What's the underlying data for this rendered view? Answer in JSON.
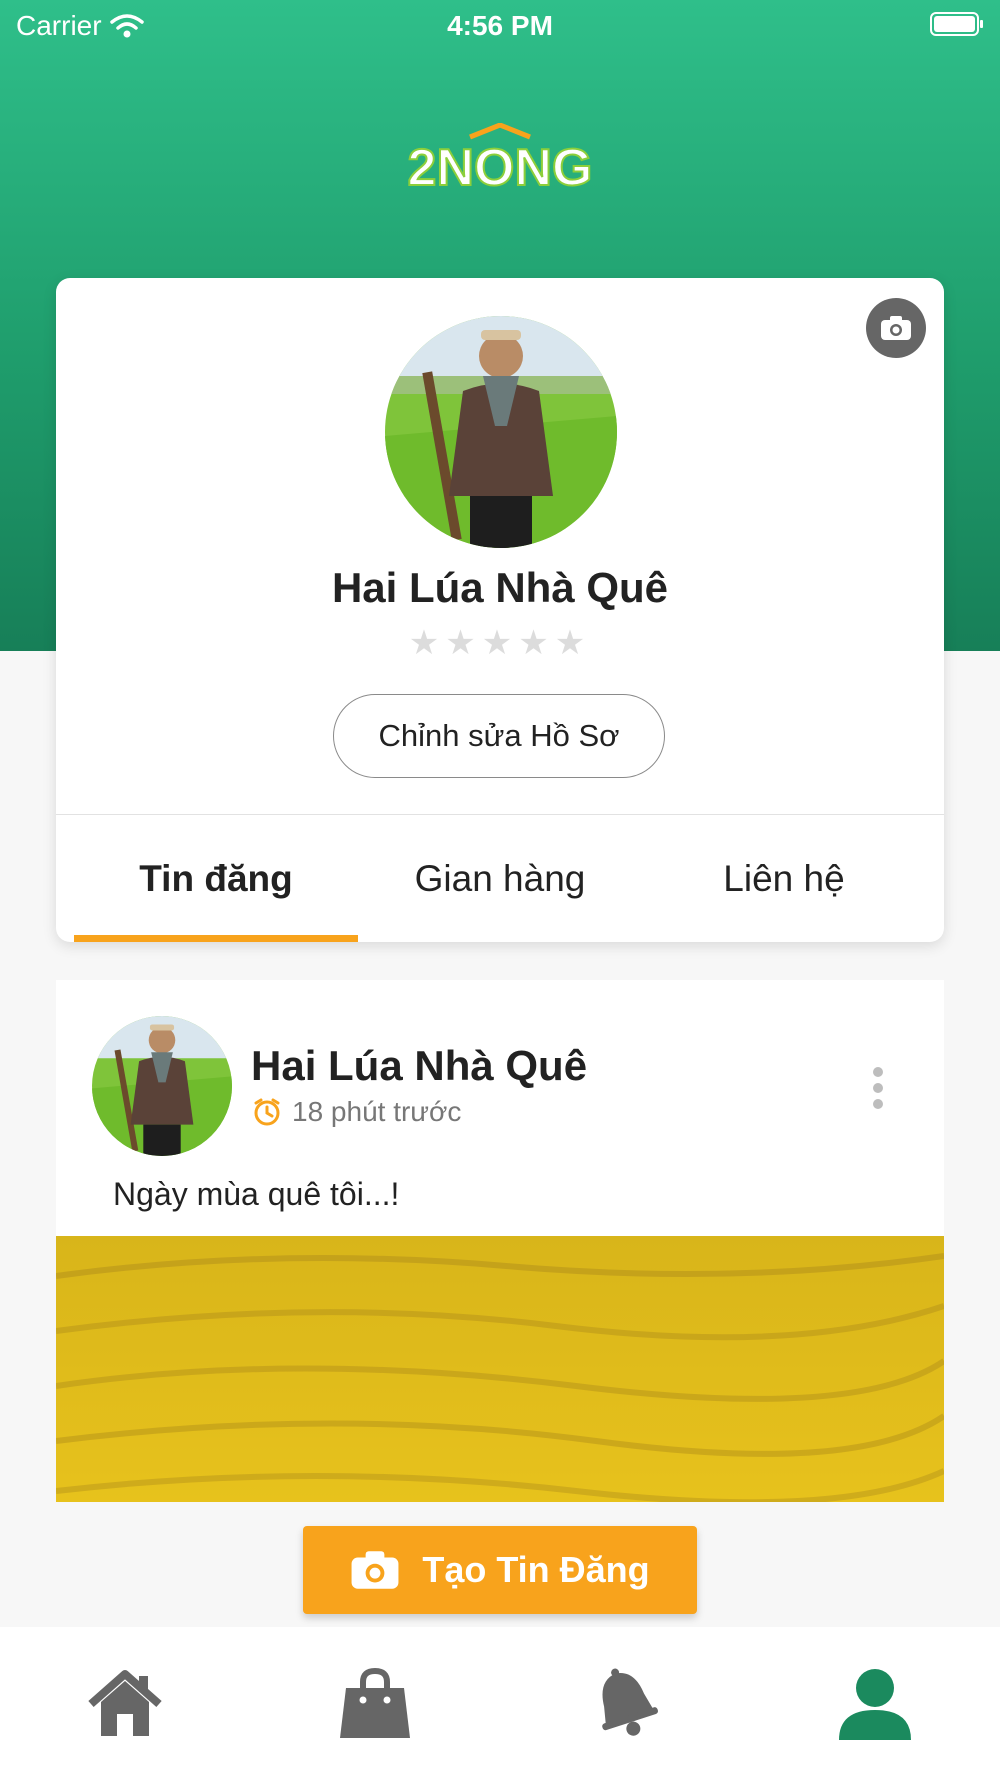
{
  "status_bar": {
    "carrier": "Carrier",
    "time": "4:56 PM"
  },
  "app": {
    "logo_text": "2NONG",
    "brand_color": "#1f9d6c",
    "accent_color": "#f8a31c"
  },
  "profile": {
    "name": "Hai Lúa Nhà Quê",
    "rating": 0,
    "rating_max": 5,
    "edit_label": "Chỉnh sửa Hồ Sơ",
    "tabs": [
      {
        "label": "Tin đăng",
        "active": true
      },
      {
        "label": "Gian hàng",
        "active": false
      },
      {
        "label": "Liên hệ",
        "active": false
      }
    ]
  },
  "post": {
    "author": "Hai Lúa Nhà Quê",
    "time": "18 phút trước",
    "text": "Ngày mùa quê tôi...!"
  },
  "create_post": {
    "label": "Tạo Tin Đăng"
  },
  "bottom_nav": [
    {
      "icon": "home-icon",
      "active": false
    },
    {
      "icon": "shopping-bag-icon",
      "active": false
    },
    {
      "icon": "bell-icon",
      "active": false
    },
    {
      "icon": "user-icon",
      "active": true
    }
  ]
}
